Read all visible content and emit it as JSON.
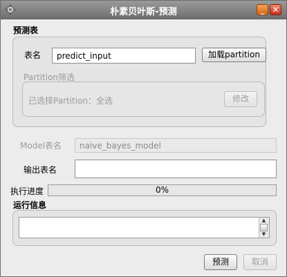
{
  "window": {
    "title": "朴素贝叶斯-预测",
    "minimize_label": "_",
    "close_label": "✕"
  },
  "predict_table": {
    "section_title": "预测表",
    "table_name_label": "表名",
    "table_name_value": "predict_input",
    "load_partition_button": "加载partition"
  },
  "partition_filter": {
    "section_title": "Partition筛选",
    "selected_text": "已选择Partition：全选",
    "edit_button": "修改"
  },
  "model": {
    "model_table_label": "Model表名",
    "model_table_value": "naive_bayes_model",
    "output_table_label": "输出表名",
    "output_table_value": ""
  },
  "progress": {
    "label": "执行进度",
    "value_text": "0%",
    "fraction": 0
  },
  "run_info": {
    "section_title": "运行信息",
    "content": ""
  },
  "actions": {
    "predict_button": "预测",
    "cancel_button": "取消"
  },
  "colors": {
    "titlebar": "#8a8a8a",
    "window_bg": "#ececec",
    "minimize": "#e07b2a",
    "close": "#d94a2a"
  }
}
